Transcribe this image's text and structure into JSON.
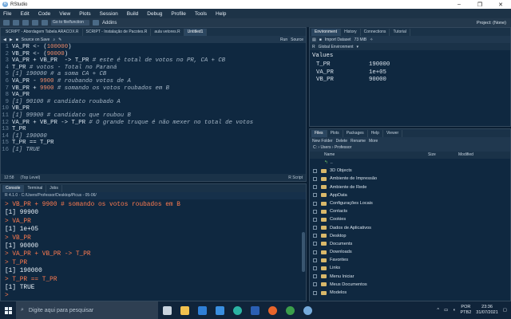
{
  "window": {
    "title": "RStudio",
    "minimize": "–",
    "maximize": "❐",
    "close": "✕"
  },
  "menu": [
    "File",
    "Edit",
    "Code",
    "View",
    "Plots",
    "Session",
    "Build",
    "Debug",
    "Profile",
    "Tools",
    "Help"
  ],
  "toolbar": {
    "goto_placeholder": "Go to file/function",
    "addins": "Addins",
    "project": "Project: (None)"
  },
  "editor": {
    "tabs": [
      "SCRIPT - Abordagem Tabela ARACOX.R",
      "SCRIPT - Instalação de Pacotes.R",
      "aula vetores.R",
      "Untitled1"
    ],
    "active_tab": 3,
    "source_on_save": "Source on Save",
    "run": "Run",
    "source": "Source",
    "lines": [
      [
        {
          "t": "VA_PR <- (",
          "c": "def"
        },
        {
          "t": "100000",
          "c": "num"
        },
        {
          "t": ")",
          "c": "def"
        }
      ],
      [
        {
          "t": "VB_PR <- (",
          "c": "def"
        },
        {
          "t": "90000",
          "c": "num"
        },
        {
          "t": ")",
          "c": "def"
        }
      ],
      [
        {
          "t": "VA_PR + VB_PR  -> T_PR ",
          "c": "def"
        },
        {
          "t": "# este é total de votos no PR, CA + CB",
          "c": "com"
        }
      ],
      [
        {
          "t": "T_PR ",
          "c": "def"
        },
        {
          "t": "# votos - Total no Paraná",
          "c": "com"
        }
      ],
      [
        {
          "t": "[1] 190000 ",
          "c": "com"
        },
        {
          "t": "# a soma CA + CB",
          "c": "com"
        }
      ],
      [
        {
          "t": "VA_PR - ",
          "c": "def"
        },
        {
          "t": "9900",
          "c": "num"
        },
        {
          "t": " # roubando votos de A",
          "c": "com"
        }
      ],
      [
        {
          "t": "VB_PR + ",
          "c": "def"
        },
        {
          "t": "9900",
          "c": "num"
        },
        {
          "t": " # somando os votos roubados em B",
          "c": "com"
        }
      ],
      [
        {
          "t": "VA_PR",
          "c": "def"
        }
      ],
      [
        {
          "t": "[1] 90100 ",
          "c": "com"
        },
        {
          "t": "# candidato roubado A",
          "c": "com"
        }
      ],
      [
        {
          "t": "VB_PR",
          "c": "def"
        }
      ],
      [
        {
          "t": "[1] 99900 ",
          "c": "com"
        },
        {
          "t": "# candidato que roubou B",
          "c": "com"
        }
      ],
      [
        {
          "t": "VA_PR + VB_PR -> T_PR ",
          "c": "def"
        },
        {
          "t": "# O grande truque é não mexer no total de votos",
          "c": "com"
        }
      ],
      [
        {
          "t": "T_PR",
          "c": "def"
        }
      ],
      [
        {
          "t": "[1] 190000",
          "c": "com"
        }
      ],
      [
        {
          "t": "T_PR == T_PR",
          "c": "def"
        }
      ],
      [
        {
          "t": "[1] TRUE",
          "c": "com"
        }
      ]
    ],
    "status_pos": "12:58",
    "status_level": "(Top Level)",
    "status_type": "R Script"
  },
  "console": {
    "tabs": [
      "Console",
      "Terminal",
      "Jobs"
    ],
    "path": "R 4.1.0 · C:/Users/Professor/Desktop/Picus - 05-06/",
    "lines": [
      {
        "p": "> ",
        "t": "VB_PR + 9900 # somando os votos roubados em B",
        "k": "cmd"
      },
      {
        "p": "",
        "t": "[1] 99900",
        "k": "out"
      },
      {
        "p": "> ",
        "t": "VA_PR",
        "k": "cmd"
      },
      {
        "p": "",
        "t": "[1] 1e+05",
        "k": "out"
      },
      {
        "p": "> ",
        "t": "VB_PR",
        "k": "cmd"
      },
      {
        "p": "",
        "t": "[1] 90000",
        "k": "out"
      },
      {
        "p": "> ",
        "t": "VA_PR + VB_PR -> T_PR",
        "k": "cmd"
      },
      {
        "p": "> ",
        "t": "T_PR",
        "k": "cmd"
      },
      {
        "p": "",
        "t": "[1] 190000",
        "k": "out"
      },
      {
        "p": "> ",
        "t": "T_PR == T_PR",
        "k": "cmd"
      },
      {
        "p": "",
        "t": "[1] TRUE",
        "k": "out"
      },
      {
        "p": "> ",
        "t": "",
        "k": "cmd"
      }
    ]
  },
  "environment": {
    "tabs": [
      "Environment",
      "History",
      "Connections",
      "Tutorial"
    ],
    "import": "Import Dataset",
    "memory": "73 MiB",
    "scope": "Global Environment",
    "header": "Values",
    "rows": [
      {
        "name": "T_PR",
        "value": "190000"
      },
      {
        "name": "VA_PR",
        "value": "1e+05"
      },
      {
        "name": "VB_PR",
        "value": "90000"
      }
    ]
  },
  "files": {
    "tabs": [
      "Files",
      "Plots",
      "Packages",
      "Help",
      "Viewer"
    ],
    "actions": [
      "New Folder",
      "Delete",
      "Rename",
      "More"
    ],
    "crumb": "C: › Users › Professor",
    "columns": [
      "Name",
      "Size",
      "Modified"
    ],
    "up": "..",
    "items": [
      "3D Objects",
      "Ambiente de Impressão",
      "Ambiente de Rede",
      "AppData",
      "Configurações Locais",
      "Contacts",
      "Cookies",
      "Dados de Aplicativos",
      "Desktop",
      "Documents",
      "Downloads",
      "Favorites",
      "Links",
      "Menu Iniciar",
      "Meus Documentos",
      "Modelos"
    ]
  },
  "taskbar": {
    "search_placeholder": "Digite aqui para pesquisar",
    "lang": "POR",
    "lang2": "PTB2",
    "time": "23:36",
    "date": "31/07/2021",
    "apps": [
      {
        "name": "task-view",
        "color": "#c8d3de"
      },
      {
        "name": "explorer",
        "color": "#f2c14e"
      },
      {
        "name": "mail",
        "color": "#2f7fd6"
      },
      {
        "name": "store",
        "color": "#3a8fe0"
      },
      {
        "name": "edge",
        "color": "#2bb3a3"
      },
      {
        "name": "word",
        "color": "#2b5fb3"
      },
      {
        "name": "firefox",
        "color": "#e8652b"
      },
      {
        "name": "chrome",
        "color": "#3b9e4b"
      },
      {
        "name": "rstudio",
        "color": "#75aadb"
      }
    ]
  }
}
